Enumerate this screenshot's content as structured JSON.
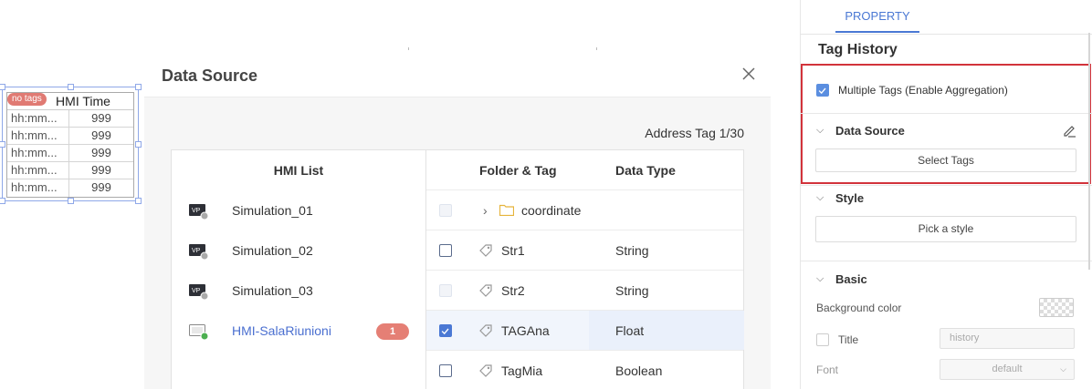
{
  "widget": {
    "title": "HMI Time",
    "no_tags": "no tags",
    "rows": [
      {
        "time": "hh:mm...",
        "value": "999"
      },
      {
        "time": "hh:mm...",
        "value": "999"
      },
      {
        "time": "hh:mm...",
        "value": "999"
      },
      {
        "time": "hh:mm...",
        "value": "999"
      },
      {
        "time": "hh:mm...",
        "value": "999"
      }
    ]
  },
  "modal": {
    "title": "Data Source",
    "address_tag": "Address Tag 1/30",
    "hmi_list_header": "HMI List",
    "hmi_items": [
      {
        "label": "Simulation_01"
      },
      {
        "label": "Simulation_02"
      },
      {
        "label": "Simulation_03"
      },
      {
        "label": "HMI-SalaRiunioni",
        "badge": "1",
        "selected": true
      }
    ],
    "tag_headers": {
      "folder_tag": "Folder & Tag",
      "data_type": "Data Type"
    },
    "tags": [
      {
        "name": "coordinate",
        "type": "",
        "kind": "folder",
        "checkbox": "disabled"
      },
      {
        "name": "Str1",
        "type": "String",
        "kind": "tag",
        "checkbox": "unchecked"
      },
      {
        "name": "Str2",
        "type": "String",
        "kind": "tag",
        "checkbox": "disabled"
      },
      {
        "name": "TAGAna",
        "type": "Float",
        "kind": "tag",
        "checkbox": "checked"
      },
      {
        "name": "TagMia",
        "type": "Boolean",
        "kind": "tag",
        "checkbox": "unchecked"
      }
    ]
  },
  "property": {
    "tab": "PROPERTY",
    "title": "Tag History",
    "multiple_tags_label": "Multiple Tags (Enable Aggregation)",
    "multiple_tags_checked": true,
    "data_source": {
      "title": "Data Source",
      "button": "Select Tags"
    },
    "style": {
      "title": "Style",
      "button": "Pick a style"
    },
    "basic": {
      "title": "Basic",
      "background_color_label": "Background color",
      "title_label": "Title",
      "title_placeholder": "history",
      "font_label": "Font",
      "font_value": "default"
    }
  },
  "colors": {
    "accent": "#4a78d4",
    "highlight_box": "#d2333b",
    "badge": "#e57f75"
  }
}
